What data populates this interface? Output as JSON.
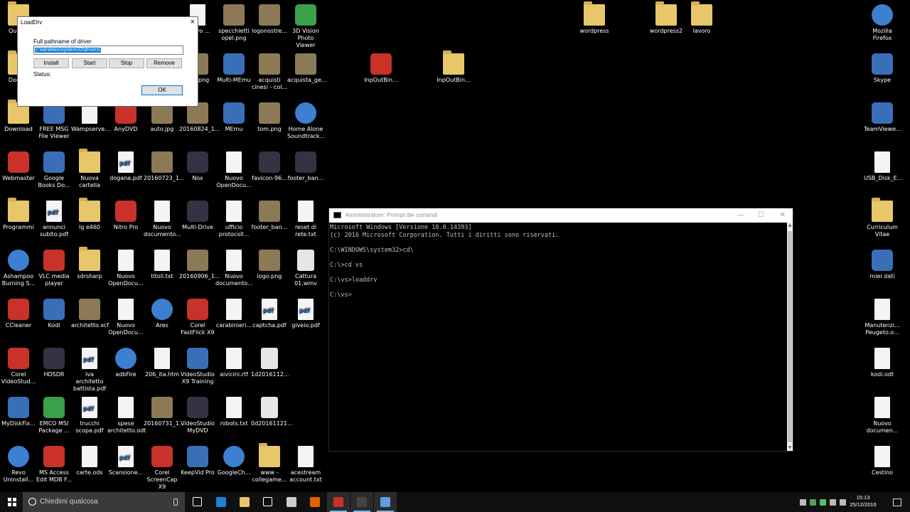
{
  "desktop_icons": [
    {
      "label": "Ques...",
      "t": "folder"
    },
    {
      "label": "Docu...",
      "t": "folder"
    },
    {
      "label": "Download",
      "t": "folder"
    },
    {
      "label": "Webmaster",
      "t": "red"
    },
    {
      "label": "Programmi",
      "t": "folder"
    },
    {
      "label": "Ashampoo Burning S...",
      "t": "round"
    },
    {
      "label": "CCleaner",
      "t": "red"
    },
    {
      "label": "Corel VideoStud...",
      "t": "red"
    },
    {
      "label": "MyDiskFix...",
      "t": "app"
    },
    {
      "label": "Revo Uninstall...",
      "t": "round"
    },
    {
      "label": "FREE MSG File Viewer",
      "t": "app"
    },
    {
      "label": "Google Books Do...",
      "t": "app"
    },
    {
      "label": "annunci subito.pdf",
      "t": "pdf"
    },
    {
      "label": "VLC media player",
      "t": "red"
    },
    {
      "label": "Kodi",
      "t": "app"
    },
    {
      "label": "HDSDR",
      "t": "dark"
    },
    {
      "label": "EMCO MSI Package ...",
      "t": "green"
    },
    {
      "label": "MS Access Edit MDB F...",
      "t": "red"
    },
    {
      "label": "Wampserve...",
      "t": "doc"
    },
    {
      "label": "Nuova cartella",
      "t": "folder"
    },
    {
      "label": "lg e460",
      "t": "folder"
    },
    {
      "label": "sdrsharp",
      "t": "folder"
    },
    {
      "label": "architetto.xcf",
      "t": "img"
    },
    {
      "label": "iva architetto battista.pdf",
      "t": "pdf"
    },
    {
      "label": "trucchi scopa.pdf",
      "t": "pdf"
    },
    {
      "label": "carte.ods",
      "t": "doc"
    },
    {
      "label": "AnyDVD",
      "t": "red"
    },
    {
      "label": "dogana.pdf",
      "t": "pdf"
    },
    {
      "label": "Nitro Pro",
      "t": "red"
    },
    {
      "label": "Nuovo OpenDocu...",
      "t": "doc"
    },
    {
      "label": "Nuovo OpenDocu...",
      "t": "doc"
    },
    {
      "label": "adbFire",
      "t": "round"
    },
    {
      "label": "spese architetto.odt",
      "t": "doc"
    },
    {
      "label": "Scansione...",
      "t": "pdf"
    },
    {
      "label": "auto.jpg",
      "t": "img"
    },
    {
      "label": "20160723_1...",
      "t": "img"
    },
    {
      "label": "Nuovo documento...",
      "t": "doc"
    },
    {
      "label": "titoli.txt",
      "t": "doc"
    },
    {
      "label": "Ares",
      "t": "round"
    },
    {
      "label": "206_ita.htm",
      "t": "doc"
    },
    {
      "label": "20160731_1...",
      "t": "img"
    },
    {
      "label": "Corel ScreenCap X9",
      "t": "red"
    },
    {
      "label": "20160824_1...",
      "t": "img"
    },
    {
      "label": "Nox",
      "t": "dark"
    },
    {
      "label": "Multi-Drive",
      "t": "dark"
    },
    {
      "label": "20160906_1...",
      "t": "img"
    },
    {
      "label": "Corel FastFlick X9",
      "t": "red"
    },
    {
      "label": "VideoStudio X9 Training",
      "t": "app"
    },
    {
      "label": "VideoStudio MyDVD",
      "t": "dark"
    },
    {
      "label": "KeepVid Pro",
      "t": "app"
    },
    {
      "label": "specchietti opel.png",
      "t": "img"
    },
    {
      "label": "Multi-MEmu",
      "t": "app"
    },
    {
      "label": "MEmu",
      "t": "app"
    },
    {
      "label": "Nuovo OpenDocu...",
      "t": "doc"
    },
    {
      "label": "ufficio protocoll...",
      "t": "doc"
    },
    {
      "label": "Nuovo documento...",
      "t": "doc"
    },
    {
      "label": "carabinieri...",
      "t": "doc"
    },
    {
      "label": "aivicini.rtf",
      "t": "doc"
    },
    {
      "label": "robots.txt",
      "t": "doc"
    },
    {
      "label": "GoogleCh...",
      "t": "round"
    },
    {
      "label": "logonostre...",
      "t": "img"
    },
    {
      "label": "acquisti cinesi - col...",
      "t": "img"
    },
    {
      "label": "tom.png",
      "t": "img"
    },
    {
      "label": "favicon-96...",
      "t": "dark"
    },
    {
      "label": "footer_ban...",
      "t": "img"
    },
    {
      "label": "logo.png",
      "t": "img"
    },
    {
      "label": "captcha.pdf",
      "t": "pdf"
    },
    {
      "label": "1d2016112...",
      "t": "media"
    },
    {
      "label": "0d20161121...",
      "t": "media"
    },
    {
      "label": "www - collegame...",
      "t": "folder"
    },
    {
      "label": "3D Vision Photo Viewer",
      "t": "green"
    },
    {
      "label": "acquista_ge...",
      "t": "img"
    },
    {
      "label": "Home Alone Soundtrack...",
      "t": "round"
    },
    {
      "label": "footer_ban...",
      "t": "dark"
    },
    {
      "label": "reset di rete.txt",
      "t": "doc"
    },
    {
      "label": "Cattura 01.wmv",
      "t": "media"
    },
    {
      "label": "giveio.pdf",
      "t": "pdf"
    },
    {
      "label": "acestream account.txt",
      "t": "doc"
    },
    {
      "label": "InpOutBin...",
      "t": "red"
    },
    {
      "label": "InpOutBin...",
      "t": "folder"
    },
    {
      "label": "wordpress",
      "t": "folder"
    },
    {
      "label": "wordpress2",
      "t": "folder"
    },
    {
      "label": "lavoro",
      "t": "folder"
    },
    {
      "label": "Mozilla Firefox",
      "t": "round"
    },
    {
      "label": "Skype",
      "t": "app"
    },
    {
      "label": "TeamViewe...",
      "t": "app"
    },
    {
      "label": "USB_Disk_E...",
      "t": "doc"
    },
    {
      "label": "Curriculum Vitae",
      "t": "folder"
    },
    {
      "label": "miei dati",
      "t": "app"
    },
    {
      "label": "Manutenzi... Peugeto.o...",
      "t": "doc"
    },
    {
      "label": "kodi.odt",
      "t": "doc"
    },
    {
      "label": "Nuovo documen...",
      "t": "doc"
    },
    {
      "label": "Cestino",
      "t": "doc"
    },
    {
      "label": "nuovo ...",
      "t": "doc"
    },
    {
      "label": "...el.png",
      "t": "img"
    }
  ],
  "loaddrv": {
    "title": "LoadDrv",
    "close": "×",
    "path_label": "Full pathname of driver",
    "path_value": "c:\\windows\\system32\\drivers\\",
    "buttons": [
      "Install",
      "Start",
      "Stop",
      "Remove"
    ],
    "status_label": "Status:",
    "ok": "OK"
  },
  "console": {
    "title": "Amministratore: Prompt dei comandi",
    "minimize": "—",
    "maximize": "☐",
    "close": "✕",
    "lines": [
      "Microsoft Windows [Versione 10.0.14393]",
      "(c) 2016 Microsoft Corporation. Tutti i diritti sono riservati.",
      "",
      "C:\\WINDOWS\\system32>cd\\",
      "",
      "C:\\>cd vs",
      "",
      "C:\\vs>loaddrv",
      "",
      "C:\\vs>"
    ]
  },
  "taskbar": {
    "search_placeholder": "Chiedimi qualcosa",
    "apps": [
      "task-view",
      "edge",
      "file-explorer",
      "store",
      "calculator",
      "firefox",
      "corel",
      "cmd",
      "loaddrv"
    ],
    "time": "15:13",
    "date": "25/12/2016"
  }
}
